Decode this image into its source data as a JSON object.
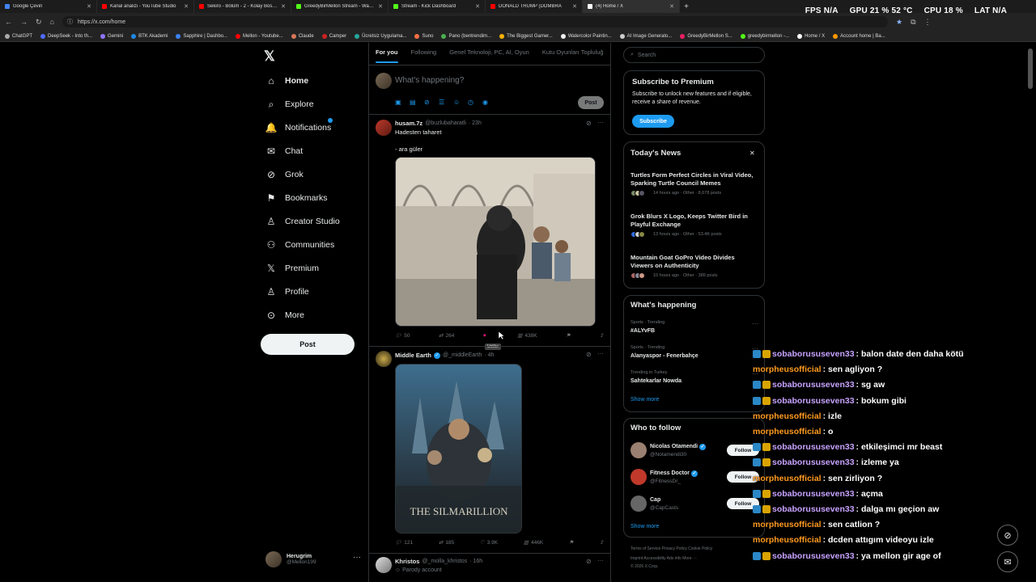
{
  "browser": {
    "tabs": [
      {
        "title": "Google Çeviri",
        "color": "#4285f4",
        "active": false
      },
      {
        "title": "Kanal analizi - YouTube Studio",
        "color": "#ff0000",
        "active": false
      },
      {
        "title": "Sekiro - Bölüm - 2 - Kolay Boss ?!",
        "color": "#ff0000",
        "active": false
      },
      {
        "title": "GreedyBirMellon Stream - Watch Li",
        "color": "#53fc18",
        "active": false
      },
      {
        "title": "Stream - Kick Dashboard",
        "color": "#53fc18",
        "active": false
      },
      {
        "title": "DONALD TRUMP (DOMBRA",
        "color": "#ff0000",
        "active": false
      },
      {
        "title": "(4) Home / X",
        "color": "#ffffff",
        "active": true
      }
    ],
    "new_tab": "+",
    "url": "https://x.com/home",
    "bookmarks": [
      {
        "label": "ChatGPT",
        "color": "#aaaaaa"
      },
      {
        "label": "DeepSeek - Into th...",
        "color": "#4d6bfe"
      },
      {
        "label": "Gemini",
        "color": "#8e75ff"
      },
      {
        "label": "BTK Akademi",
        "color": "#1e88e5"
      },
      {
        "label": "Sapphire | Dashbo...",
        "color": "#3b82f6"
      },
      {
        "label": "Mellon - Youtube...",
        "color": "#ff0000"
      },
      {
        "label": "Claude",
        "color": "#d97757"
      },
      {
        "label": "Camper",
        "color": "#cc2222"
      },
      {
        "label": "Ücretsiz Uygulama...",
        "color": "#26a69a"
      },
      {
        "label": "Suno",
        "color": "#ff7043"
      },
      {
        "label": "Pano (bentrendim...",
        "color": "#4caf50"
      },
      {
        "label": "The Biggest Gamer...",
        "color": "#ffb300"
      },
      {
        "label": "Watercolor Paintin...",
        "color": "#eeeeee"
      },
      {
        "label": "AI Image Generato...",
        "color": "#cccccc"
      },
      {
        "label": "GreedyBirMellon S...",
        "color": "#e91e63"
      },
      {
        "label": "greedybirmellon -...",
        "color": "#53fc18"
      },
      {
        "label": "Home / X",
        "color": "#ffffff"
      },
      {
        "label": "Account home | Ba...",
        "color": "#ff9800"
      }
    ]
  },
  "perf_overlay": {
    "fps_label": "FPS",
    "fps_value": "N/A",
    "gpu_label": "GPU",
    "gpu_value": "21 % 52 °C",
    "cpu_label": "CPU",
    "cpu_value": "18 %",
    "lat_label": "LAT",
    "lat_value": "N/A"
  },
  "sidebar": {
    "logo": "𝕏",
    "items": [
      {
        "label": "Home",
        "icon": "home-icon",
        "glyph": "⌂",
        "bold": true
      },
      {
        "label": "Explore",
        "icon": "search-icon",
        "glyph": "⌕",
        "bold": false
      },
      {
        "label": "Notifications",
        "icon": "bell-icon",
        "glyph": "🔔",
        "bold": false
      },
      {
        "label": "Chat",
        "icon": "mail-icon",
        "glyph": "✉",
        "bold": false
      },
      {
        "label": "Grok",
        "icon": "grok-icon",
        "glyph": "⊘",
        "bold": false
      },
      {
        "label": "Bookmarks",
        "icon": "bookmark-icon",
        "glyph": "⚑",
        "bold": false
      },
      {
        "label": "Creator Studio",
        "icon": "creator-icon",
        "glyph": "♙",
        "bold": false
      },
      {
        "label": "Communities",
        "icon": "communities-icon",
        "glyph": "⚇",
        "bold": false
      },
      {
        "label": "Premium",
        "icon": "x-premium-icon",
        "glyph": "𝕏",
        "bold": false
      },
      {
        "label": "Profile",
        "icon": "profile-icon",
        "glyph": "♙",
        "bold": false
      },
      {
        "label": "More",
        "icon": "more-icon",
        "glyph": "⊙",
        "bold": false
      }
    ],
    "post_button": "Post",
    "account": {
      "name": "Herugrim",
      "handle": "@Mellon199",
      "more": "···"
    }
  },
  "feed": {
    "tabs": [
      "For you",
      "Following",
      "Genel Teknoloji, PC, AI, Oyun",
      "Kutu Oyunları Topluluğ"
    ],
    "compose_placeholder": "What's happening?",
    "compose_post": "Post",
    "tweets": [
      {
        "name": "husam.7z",
        "handle": "@buzlubaharatli",
        "time": "· 23h",
        "text1": "Hadesten taharet",
        "text2": "- ara güler",
        "replies": "50",
        "reposts": "264",
        "likes": "",
        "views": "438K",
        "tooltip": "Unlike"
      },
      {
        "name": "Middle Earth",
        "handle": "@_middleEarth",
        "time": "· 4h",
        "poster_title": "THE SILMARILLION",
        "replies": "121",
        "reposts": "185",
        "likes": "3.9K",
        "views": "446K"
      },
      {
        "name": "Khristos",
        "handle": "@_molla_khristos",
        "time": "· 16h",
        "text1": "Parody account"
      }
    ]
  },
  "right": {
    "search_placeholder": "Search",
    "premium": {
      "title": "Subscribe to Premium",
      "body": "Subscribe to unlock new features and if eligible, receive a share of revenue.",
      "button": "Subscribe"
    },
    "news": {
      "title": "Today's News",
      "close": "✕",
      "items": [
        {
          "headline": "Turtles Form Perfect Circles in Viral Video, Sparking Turtle Council Memes",
          "meta": "14 hours ago · Other · 8,678 posts"
        },
        {
          "headline": "Grok Blurs X Logo, Keeps Twitter Bird in Playful Exchange",
          "meta": "13 hours ago · Other · 53.4K posts"
        },
        {
          "headline": "Mountain Goat GoPro Video Divides Viewers on Authenticity",
          "meta": "10 hours ago · Other · 389 posts"
        }
      ]
    },
    "happening": {
      "title": "What's happening",
      "items": [
        {
          "context": "Sports · Trending",
          "topic": "#ALYvFB"
        },
        {
          "context": "Sports · Trending",
          "topic": "Alanyaspor - Fenerbahçe"
        },
        {
          "context": "Trending in Turkey",
          "topic": "Sahtekarlar Nowda"
        }
      ],
      "show_more": "Show more"
    },
    "follow": {
      "title": "Who to follow",
      "items": [
        {
          "name": "Nicolas Otamendi",
          "handle": "@Notamendi30",
          "button": "Follow"
        },
        {
          "name": "Fitness Doctor",
          "handle": "@FitnessDr_",
          "button": "Follow"
        },
        {
          "name": "Cap",
          "handle": "@CapCasts",
          "button": "Follow"
        }
      ],
      "show_more": "Show more"
    },
    "footer": {
      "links1": "Terms of Service   Privacy Policy   Cookie Policy",
      "links2": "Imprint   Accessibility   Ads info   More ···",
      "copyright": "© 2026 X Corp."
    }
  },
  "chat": {
    "colors": {
      "sob": "#c8a2ff",
      "mor": "#ff9a1f"
    },
    "messages": [
      {
        "user": "sobaborususeven33",
        "text": ": balon date den daha kötü",
        "kind": "sob"
      },
      {
        "user": "morpheusofficial",
        "text": ": sen agliyon ?",
        "kind": "mor"
      },
      {
        "user": "sobaborususeven33",
        "text": ": sg aw",
        "kind": "sob"
      },
      {
        "user": "sobaborususeven33",
        "text": ": bokum gibi",
        "kind": "sob"
      },
      {
        "user": "morpheusofficial",
        "text": ": izle",
        "kind": "mor"
      },
      {
        "user": "morpheusofficial",
        "text": ": o",
        "kind": "mor"
      },
      {
        "user": "sobaborususeven33",
        "text": ": etkileşimci mr beast",
        "kind": "sob"
      },
      {
        "user": "sobaborususeven33",
        "text": ": izleme ya",
        "kind": "sob"
      },
      {
        "user": "morpheusofficial",
        "text": ": sen zirliyon ?",
        "kind": "mor"
      },
      {
        "user": "sobaborususeven33",
        "text": ": açma",
        "kind": "sob"
      },
      {
        "user": "sobaborususeven33",
        "text": ": dalga mı geçion aw",
        "kind": "sob"
      },
      {
        "user": "morpheusofficial",
        "text": ": sen catlion ?",
        "kind": "mor"
      },
      {
        "user": "morpheusofficial",
        "text": ": dcden attıgım videoyu izle",
        "kind": "mor"
      },
      {
        "user": "sobaborususeven33",
        "text": ": ya mellon gir age of",
        "kind": "sob"
      }
    ]
  }
}
